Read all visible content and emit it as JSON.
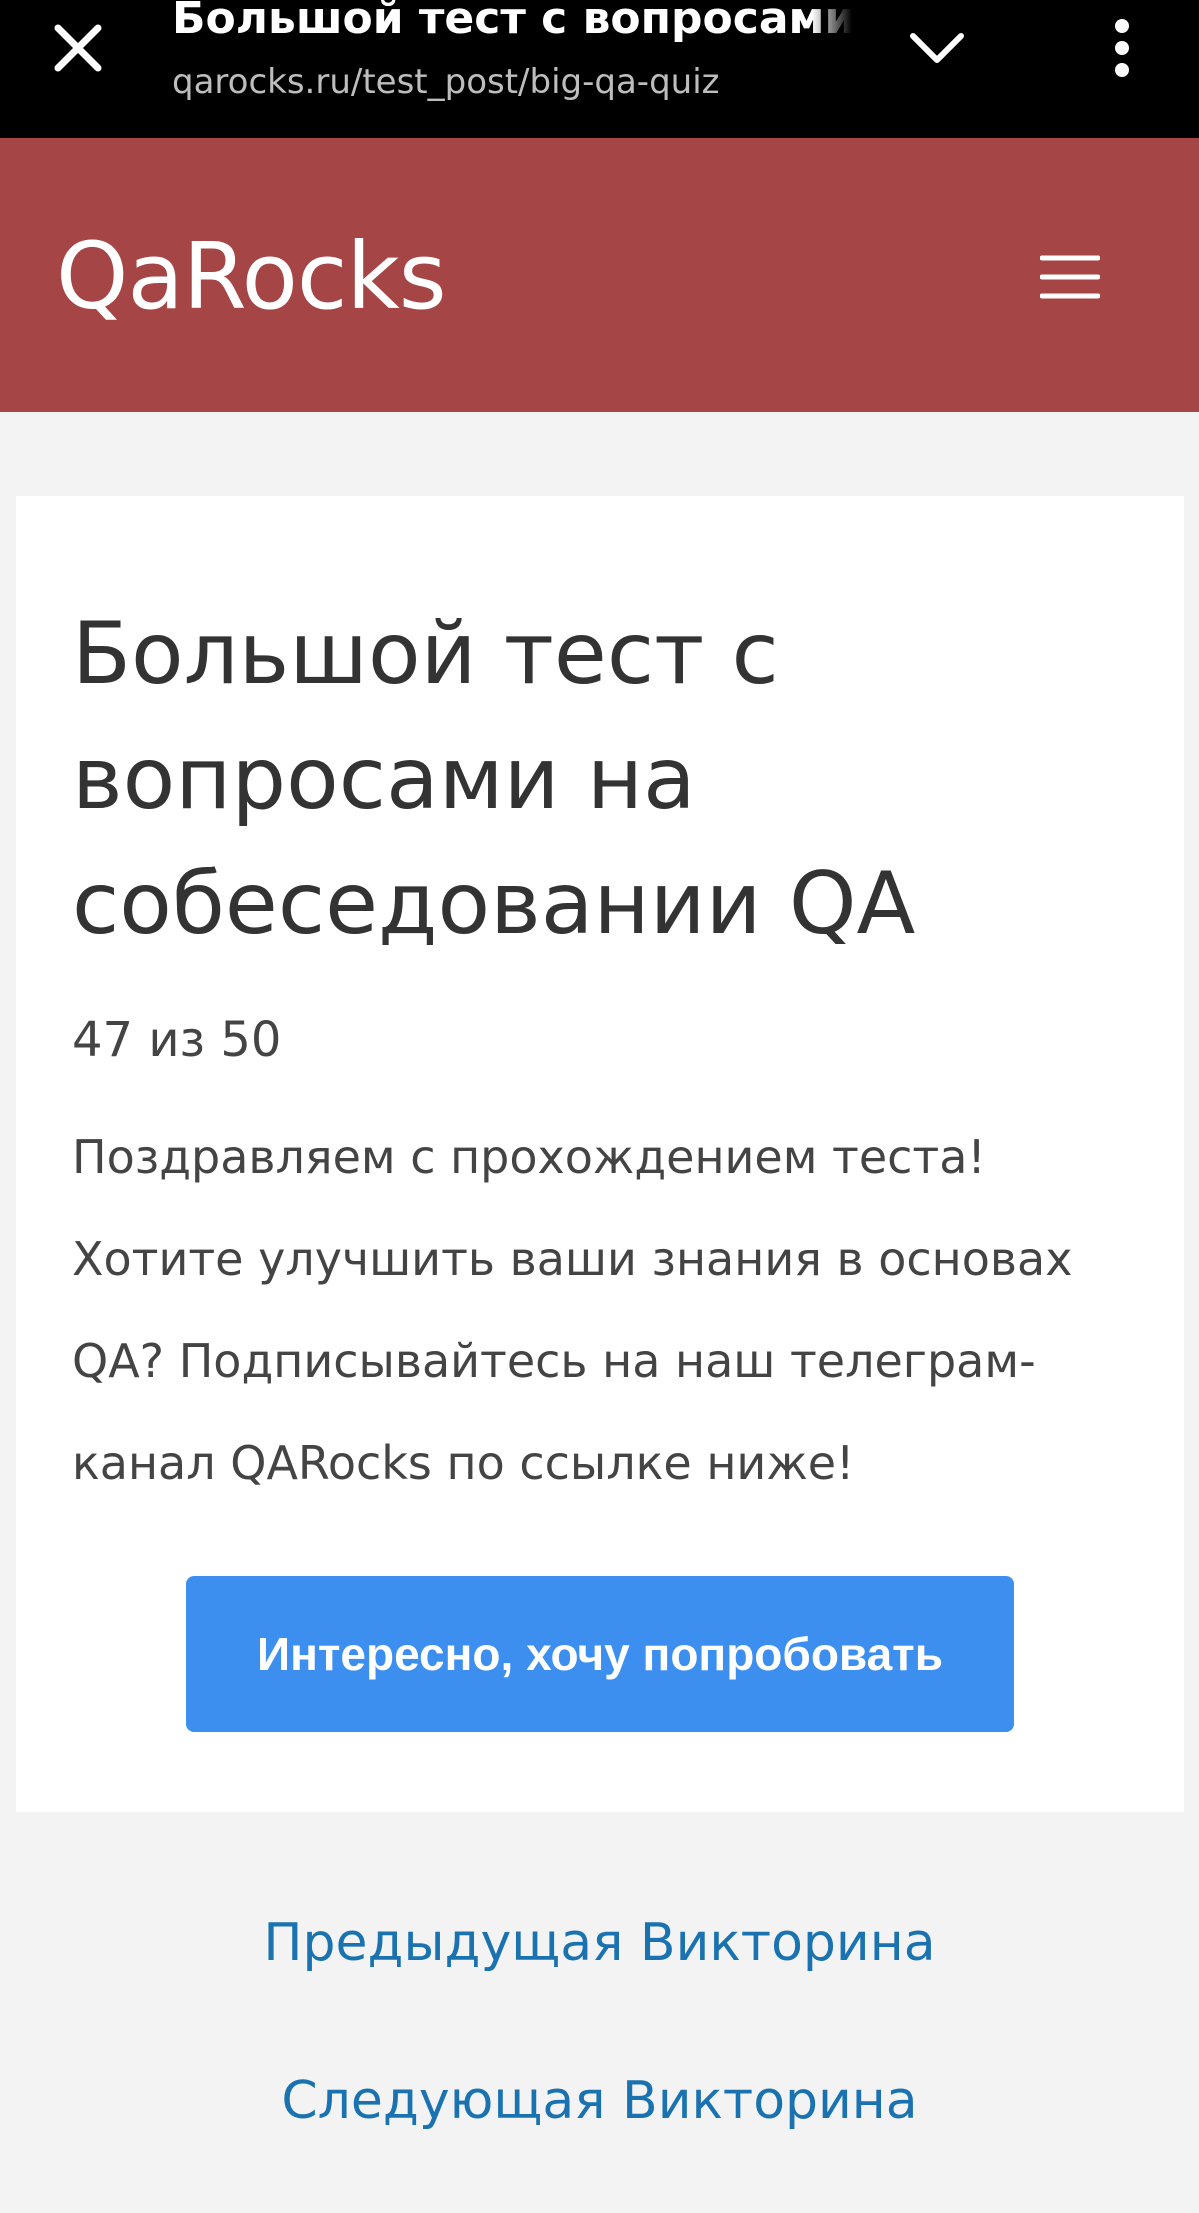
{
  "browser": {
    "title": "Большой тест с вопросами на собеседовании QA",
    "url": "qarocks.ru/test_post/big-qa-quiz",
    "close_icon": "close-icon",
    "chevron_icon": "chevron-down-icon",
    "more_icon": "more-vert-icon"
  },
  "site": {
    "logo": "QaRocks",
    "menu_icon": "hamburger-menu-icon",
    "brand_color": "#a54545"
  },
  "quiz": {
    "title": "Большой тест с вопросами на собеседовании QA",
    "score": "47 из 50",
    "message": "Поздравляем с прохождением теста! Хотите улучшить ваши знания в основах QA? Подписывайтесь на наш телеграм-канал QARocks по ссылке ниже!",
    "cta_label": "Интересно, хочу попробовать",
    "cta_color": "#3c8fef"
  },
  "navigation": {
    "previous_label": "Предыдущая Викторина",
    "next_label": "Следующая Викторина",
    "link_color": "#1a73b0"
  }
}
